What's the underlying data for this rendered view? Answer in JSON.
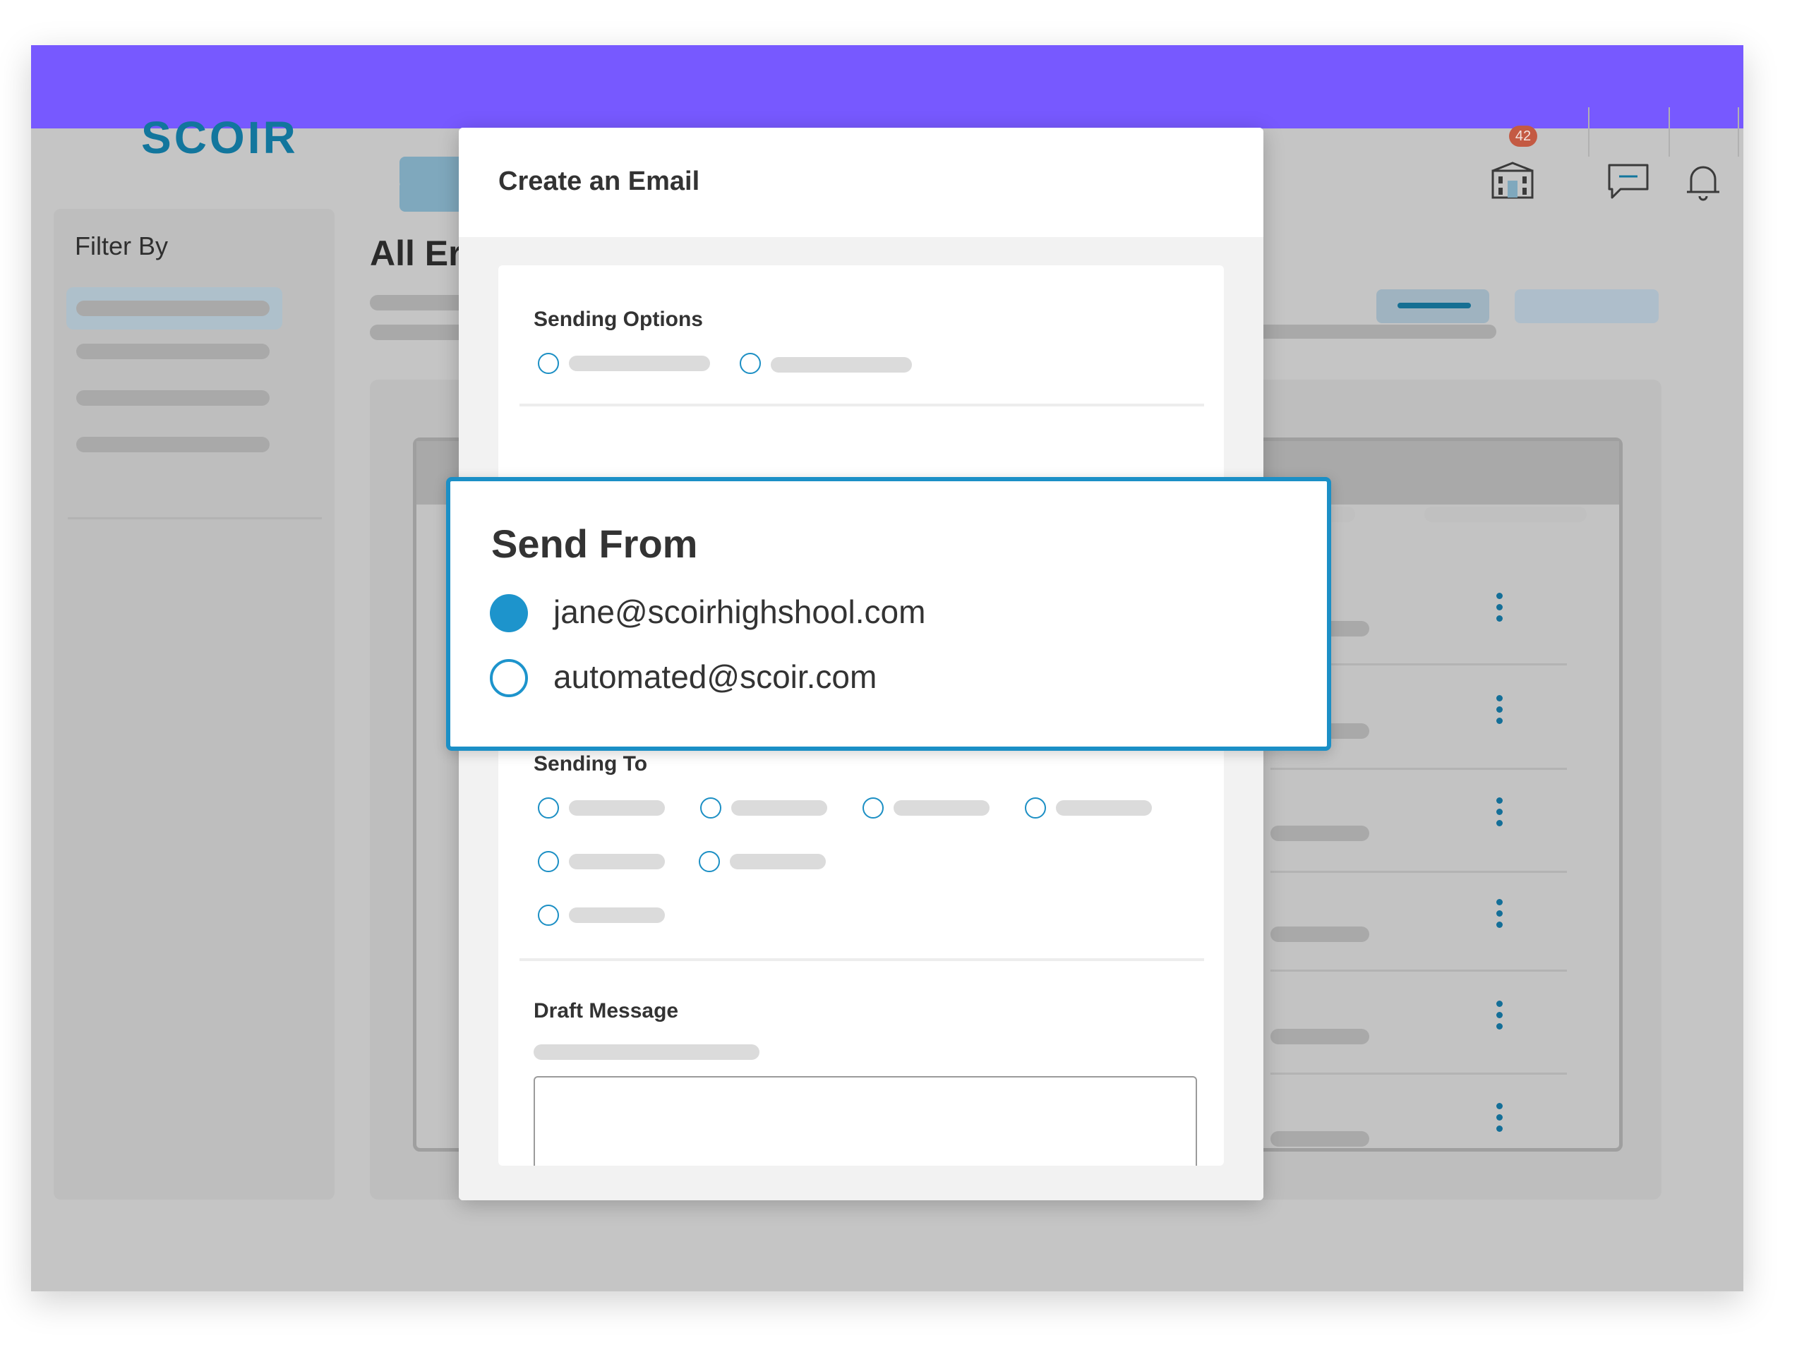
{
  "app": {
    "logo_text": "SCOIR",
    "brand_color": "#7759ff",
    "accent_color": "#1d94cc"
  },
  "header": {
    "icons": [
      "college-building-icon",
      "chat-icon",
      "bell-icon"
    ],
    "badge_count": "42"
  },
  "sidebar": {
    "title": "Filter By"
  },
  "main": {
    "title": "All Er"
  },
  "modal": {
    "title": "Create an Email",
    "sections": {
      "sending_options": "Sending Options",
      "sending_to": "Sending To",
      "draft_message": "Draft Message"
    }
  },
  "send_from": {
    "title": "Send From",
    "options": [
      {
        "label": "jane@scoirhighshool.com",
        "selected": true
      },
      {
        "label": "automated@scoir.com",
        "selected": false
      }
    ]
  }
}
